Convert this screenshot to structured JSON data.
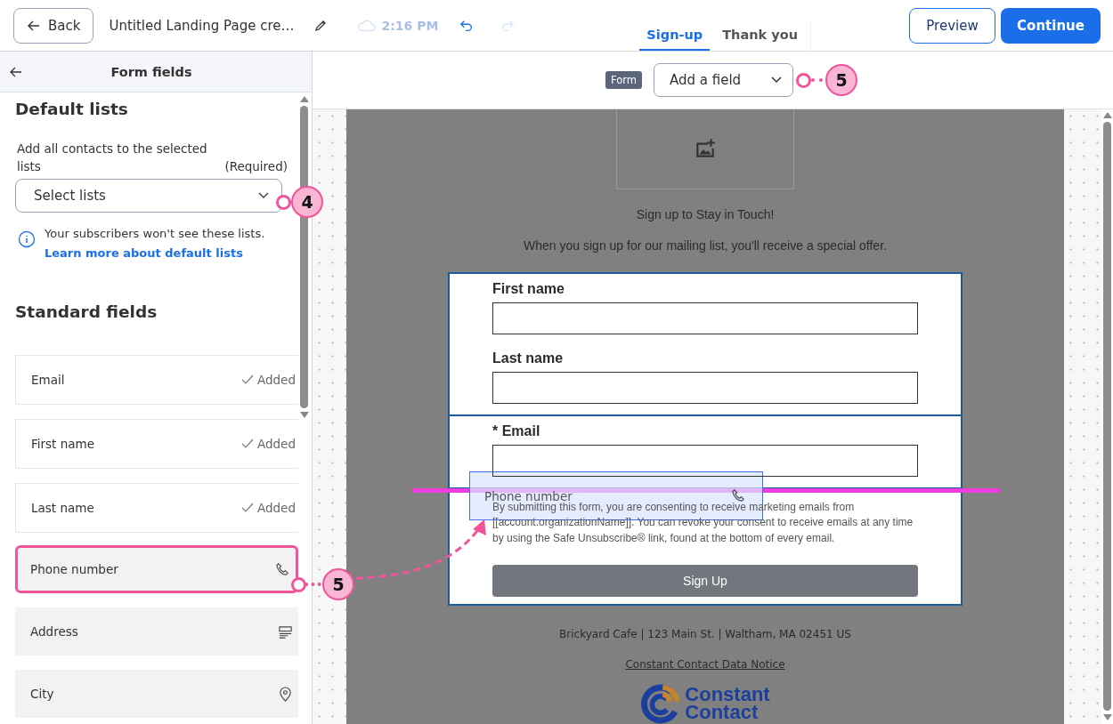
{
  "header": {
    "back_button": "Back",
    "title": "Untitled Landing Page cre…",
    "save_time": "2:16 PM",
    "undo_enabled": true,
    "redo_enabled": false,
    "tabs": [
      {
        "label": "Sign-up",
        "selected": true
      },
      {
        "label": "Thank you",
        "selected": false
      }
    ],
    "preview_button": "Preview",
    "continue_button": "Continue"
  },
  "sidebar": {
    "title": "Form fields",
    "default_lists": {
      "heading": "Default lists",
      "label": "Add all contacts to the selected lists",
      "required": "(Required)",
      "select_placeholder": "Select lists",
      "info": "Your subscribers won't see these lists.",
      "info_link": "Learn more about default lists"
    },
    "standard_fields": {
      "heading": "Standard fields",
      "fields": [
        {
          "label": "Email",
          "kind": "added",
          "status": "Added",
          "highlighted": false
        },
        {
          "label": "First name",
          "kind": "added",
          "status": "Added",
          "highlighted": false
        },
        {
          "label": "Last name",
          "kind": "added",
          "status": "Added",
          "highlighted": false
        },
        {
          "label": "Phone number",
          "kind": "phone",
          "highlighted": true
        },
        {
          "label": "Address",
          "kind": "address",
          "highlighted": false
        },
        {
          "label": "City",
          "kind": "location",
          "highlighted": false
        }
      ]
    }
  },
  "canvas": {
    "block_tag": "Form",
    "add_field_placeholder": "Add a field",
    "page": {
      "heading": "Sign up to Stay in Touch!",
      "intro": "When you sign up for our mailing list, you'll receive a special offer.",
      "required_mark": "*",
      "form_fields": [
        {
          "label": "First name",
          "required": false
        },
        {
          "label": "Last name",
          "required": false
        },
        {
          "label": "Email",
          "required": true
        }
      ],
      "consent": "By submitting this form, you are consenting to receive marketing emails from [[account.organizationName]]. You can revoke your consent to receive emails at any time by using the Safe Unsubscribe® link, found at the bottom of every email.",
      "submit_button": "Sign Up",
      "footer_address": "Brickyard Cafe | 123 Main St. | Waltham, MA 02451 US",
      "data_notice_link": "Constant Contact Data Notice",
      "logo_lines": [
        "Constant",
        "Contact"
      ]
    }
  },
  "drag_ghost": {
    "label": "Phone number"
  },
  "callouts": [
    {
      "number": "4"
    },
    {
      "number": "5"
    },
    {
      "number": "5"
    }
  ]
}
